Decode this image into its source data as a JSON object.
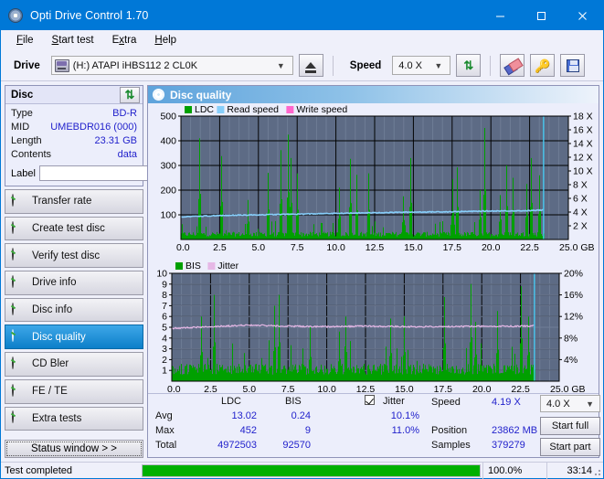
{
  "window": {
    "title": "Opti Drive Control 1.70",
    "icon": "disc-icon",
    "minimize": "–",
    "maximize": "□",
    "close": "✕",
    "accent": "#0078d7"
  },
  "menubar": {
    "items": [
      {
        "label": "File",
        "accel": "F"
      },
      {
        "label": "Start test",
        "accel": "S"
      },
      {
        "label": "Extra",
        "accel": "x"
      },
      {
        "label": "Help",
        "accel": "H"
      }
    ]
  },
  "toolbar": {
    "drive_label": "Drive",
    "drive_value": "(H:)  ATAPI iHBS112  2 CL0K",
    "eject_icon": "eject-icon",
    "speed_label": "Speed",
    "speed_value": "4.0 X",
    "refresh_icon": "refresh-icon",
    "eraser_icon": "eraser-icon",
    "keys_icon": "keys-icon",
    "save_icon": "floppy-disk-icon"
  },
  "sidebar": {
    "disc_panel": {
      "title": "Disc",
      "refresh_icon": "refresh-icon",
      "rows": [
        {
          "key": "Type",
          "value": "BD-R"
        },
        {
          "key": "MID",
          "value": "UMEBDR016 (000)"
        },
        {
          "key": "Length",
          "value": "23.31 GB"
        },
        {
          "key": "Contents",
          "value": "data"
        }
      ],
      "label_key": "Label",
      "label_value": "",
      "label_placeholder": "",
      "label_button_icon": "cd-icon"
    },
    "items": [
      {
        "label": "Transfer rate",
        "icon": "disc-icon",
        "active": false
      },
      {
        "label": "Create test disc",
        "icon": "disc-icon",
        "active": false
      },
      {
        "label": "Verify test disc",
        "icon": "disc-icon",
        "active": false
      },
      {
        "label": "Drive info",
        "icon": "disc-icon",
        "active": false
      },
      {
        "label": "Disc info",
        "icon": "disc-icon",
        "active": false
      },
      {
        "label": "Disc quality",
        "icon": "disc-icon",
        "active": true
      },
      {
        "label": "CD Bler",
        "icon": "disc-icon",
        "active": false
      },
      {
        "label": "FE / TE",
        "icon": "disc-icon",
        "active": false
      },
      {
        "label": "Extra tests",
        "icon": "disc-icon",
        "active": false
      }
    ],
    "status_window_button": "Status window > >"
  },
  "main": {
    "header_title": "Disc quality",
    "header_icon": "disc-icon"
  },
  "results": {
    "col_ldc": "LDC",
    "col_bis": "BIS",
    "jitter_label": "Jitter",
    "jitter_checked": true,
    "row_avg": "Avg",
    "row_max": "Max",
    "row_total": "Total",
    "ldc_avg": "13.02",
    "ldc_max": "452",
    "ldc_total": "4972503",
    "bis_avg": "0.24",
    "bis_max": "9",
    "bis_total": "92570",
    "jitter_avg": "10.1%",
    "jitter_max": "11.0%",
    "speed_label": "Speed",
    "speed_value": "4.19 X",
    "position_label": "Position",
    "position_value": "23862 MB",
    "samples_label": "Samples",
    "samples_value": "379279",
    "speed_select": "4.0 X",
    "start_full": "Start full",
    "start_part": "Start part"
  },
  "statusbar": {
    "message": "Test completed",
    "progress_percent": "100.0%",
    "progress_value": 100,
    "elapsed": "33:14",
    "progress_color": "#00b000"
  },
  "chart_data": [
    {
      "type": "area",
      "title": "LDC / Read speed",
      "xlabel": "GB",
      "ylabel": "LDC",
      "legend": [
        {
          "name": "LDC",
          "color": "#00a000"
        },
        {
          "name": "Read speed",
          "color": "#87cefa"
        },
        {
          "name": "Write speed",
          "color": "#ff66cc"
        }
      ],
      "legend_position": "top-left",
      "grid": true,
      "xlim": [
        0.0,
        25.0
      ],
      "xticks": [
        "0.0",
        "2.5",
        "5.0",
        "7.5",
        "10.0",
        "12.5",
        "15.0",
        "17.5",
        "20.0",
        "22.5",
        "25.0"
      ],
      "x_unit": "GB",
      "ylim": [
        0,
        500
      ],
      "yticks": [
        "100",
        "200",
        "300",
        "400",
        "500"
      ],
      "y2lim": [
        0,
        18
      ],
      "y2ticks": [
        "2 X",
        "4 X",
        "6 X",
        "8 X",
        "10 X",
        "12 X",
        "14 X",
        "16 X",
        "18 X"
      ],
      "data_end_x": 23.4,
      "series": [
        {
          "name": "LDC",
          "color": "#00a000",
          "baseline_avg": 13.02,
          "max": 452,
          "peaks_x": [
            1.2,
            2.6,
            4.3,
            5.6,
            6.4,
            6.9,
            7.1,
            7.5,
            10.2,
            10.9,
            11.3,
            12.1,
            14.3,
            14.8,
            17.5,
            17.8,
            19.3,
            19.6,
            20.6,
            21.0,
            21.4,
            22.3,
            22.6,
            23.1
          ],
          "peaks_y": [
            410,
            338,
            160,
            270,
            362,
            425,
            330,
            268,
            210,
            327,
            262,
            268,
            175,
            330,
            245,
            292,
            200,
            452,
            180,
            300,
            250,
            225,
            330,
            260
          ]
        },
        {
          "name": "Read speed",
          "color": "#87cefa",
          "unit": "X",
          "start": 3.3,
          "end": 4.3,
          "values_x": [
            0.0,
            2.5,
            5.0,
            7.5,
            10.0,
            12.5,
            15.0,
            17.5,
            20.0,
            22.5,
            23.4
          ],
          "values_y": [
            3.3,
            3.5,
            3.6,
            3.7,
            3.8,
            3.9,
            4.0,
            4.05,
            4.15,
            4.2,
            4.3
          ]
        }
      ],
      "marker_x": 23.4,
      "marker_color": "#48c8f0"
    },
    {
      "type": "area",
      "title": "BIS / Jitter",
      "xlabel": "GB",
      "ylabel": "BIS",
      "legend": [
        {
          "name": "BIS",
          "color": "#00a000"
        },
        {
          "name": "Jitter",
          "color": "#e6b8e6"
        }
      ],
      "legend_position": "top-left",
      "grid": true,
      "xlim": [
        0.0,
        25.0
      ],
      "xticks": [
        "0.0",
        "2.5",
        "5.0",
        "7.5",
        "10.0",
        "12.5",
        "15.0",
        "17.5",
        "20.0",
        "22.5",
        "25.0"
      ],
      "x_unit": "GB",
      "ylim": [
        0,
        10
      ],
      "yticks": [
        "1",
        "2",
        "3",
        "4",
        "5",
        "6",
        "7",
        "8",
        "9",
        "10"
      ],
      "y2lim": [
        0,
        20
      ],
      "y2ticks": [
        "4%",
        "8%",
        "12%",
        "16%",
        "20%"
      ],
      "data_end_x": 23.4,
      "series": [
        {
          "name": "BIS",
          "color": "#00a000",
          "baseline_avg": 0.24,
          "max": 9,
          "peaks_x": [
            1.9,
            2.7,
            6.6,
            6.9,
            8.9,
            10.8,
            11.2,
            14.1,
            15.0,
            17.6,
            19.3,
            19.6,
            21.0,
            22.5,
            23.0
          ],
          "peaks_y": [
            6.0,
            8.0,
            7.0,
            8.0,
            5.0,
            4.6,
            6.0,
            5.8,
            6.0,
            7.8,
            9.0,
            5.5,
            6.5,
            8.8,
            6.0
          ]
        },
        {
          "name": "Jitter",
          "color": "#e6b8e6",
          "unit": "%",
          "avg": 10.1,
          "max": 11.0,
          "values_x": [
            0.0,
            2.5,
            5.0,
            7.5,
            10.0,
            12.5,
            15.0,
            17.5,
            20.0,
            22.5,
            23.4
          ],
          "values_y": [
            9.8,
            10.1,
            10.4,
            10.2,
            10.1,
            10.2,
            10.1,
            10.1,
            10.2,
            10.2,
            10.3
          ]
        }
      ],
      "marker_x": 23.4,
      "marker_color": "#48c8f0"
    }
  ]
}
